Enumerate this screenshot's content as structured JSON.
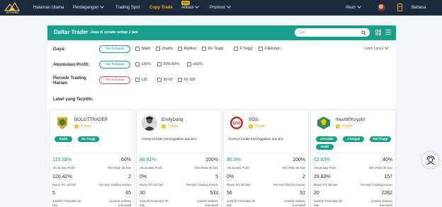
{
  "brand": {
    "logo_text": "BITYARD"
  },
  "nav": {
    "items": [
      {
        "label": "Halaman Utama"
      },
      {
        "label": "Perdagangan"
      },
      {
        "label": "Trading Spot"
      },
      {
        "label": "Copy Trade"
      },
      {
        "label": "Afiliasi"
      },
      {
        "label": "Promosi"
      }
    ],
    "new_badge": "New",
    "account": "Akun",
    "language": "Bahasa"
  },
  "header": {
    "title": "Daftar Trader",
    "subtitle": "Data di update setiap 2 jam",
    "search_placeholder": "Cari"
  },
  "filters": {
    "style": {
      "label": "Gaya:",
      "selected": "Tak Terbatas",
      "options": [
        "Stabil",
        "Utama",
        "Radikal",
        "Re.Tinggi",
        "F.Tinggi",
        "F.Rendah"
      ]
    },
    "profit": {
      "label": "Akumulasi Profit:",
      "selected": "Tak Terbatas",
      "options": [
        "≤20%",
        "20%-60%",
        "≥60%"
      ]
    },
    "period": {
      "label": "Periode Trading Harian:",
      "selected": "Tak Terbatas",
      "options": [
        "≤30",
        "30-60",
        "60-180"
      ]
    },
    "advanced": "Lebih Lanjut",
    "selected_label": "Label yang Terpilih:"
  },
  "cards": [
    {
      "name": "BOLOTTRADER",
      "badge": "Trader",
      "tags": [
        "Stabil",
        "Re.Tinggi"
      ],
      "description": "",
      "profit": "110.33%",
      "profit_label": "Akumulasi Profit",
      "winrate": "60%",
      "winrate_label": "Win Rate 30 hari",
      "pl_ratio": "120.42%",
      "pl_label": "Rasio P/L 30 hari",
      "period": "2",
      "period_label": "Periode Trading Harian",
      "tx": "5",
      "tx_label": "Jumlah Transaksi 30 hari",
      "copies": "65",
      "copies_label": "Jumlah Salinan Kumulatif"
    },
    {
      "name": "EmilyDang",
      "badge": "Trader",
      "tags": [],
      "description": "Orang ini tidak meninggalkan apa pun",
      "profit": "88.81%",
      "profit_label": "Akumulasi Profit",
      "winrate": "100%",
      "winrate_label": "Win Rate 30 hari",
      "pl_ratio": "0%",
      "pl_label": "Rasio P/L 30 hari",
      "period": "5",
      "period_label": "Periode Trading Harian",
      "tx": "30",
      "tx_label": "Jumlah Transaksi 30 hari",
      "copies": "533",
      "copies_label": "Jumlah Salinan Kumulatif"
    },
    {
      "name": "SOS",
      "badge": "Trader",
      "tags": [],
      "description": "Orang ini tidak meninggalkan apa pun",
      "profit": "86.9%",
      "profit_label": "Akumulasi Profit",
      "winrate": "100%",
      "winrate_label": "Win Rate 30 hari",
      "pl_ratio": "0%",
      "pl_label": "Rasio P/L 30 hari",
      "period": "2",
      "period_label": "Periode Trading Harian",
      "tx": "56",
      "tx_label": "Jumlah Transaksi 30 hari",
      "copies": "91",
      "copies_label": "Jumlah Salinan Kumulatif"
    },
    {
      "name": "thev0lf0fcrypt0",
      "badge": "Trader",
      "tags": [
        "J.Pendek",
        "J.Tengah",
        "Ret.Tinggi",
        "Stabil"
      ],
      "description": "",
      "profit": "62.83%",
      "profit_label": "Akumulasi Profit",
      "winrate": "40%",
      "winrate_label": "Win Rate 30 hari",
      "pl_ratio": "28.83%",
      "pl_label": "Rasio P/L 30 hari",
      "period": "157",
      "period_label": "Periode Trading Harian",
      "tx": "20",
      "tx_label": "Jumlah Transaksi 30 hari",
      "copies": "2282",
      "copies_label": "Jumlah Salinan Kumulatif"
    }
  ],
  "colors": {
    "nav_bg": "#1d2a3d",
    "accent": "#17a08c",
    "highlight": "#f2b600",
    "danger": "#e14d4d"
  }
}
